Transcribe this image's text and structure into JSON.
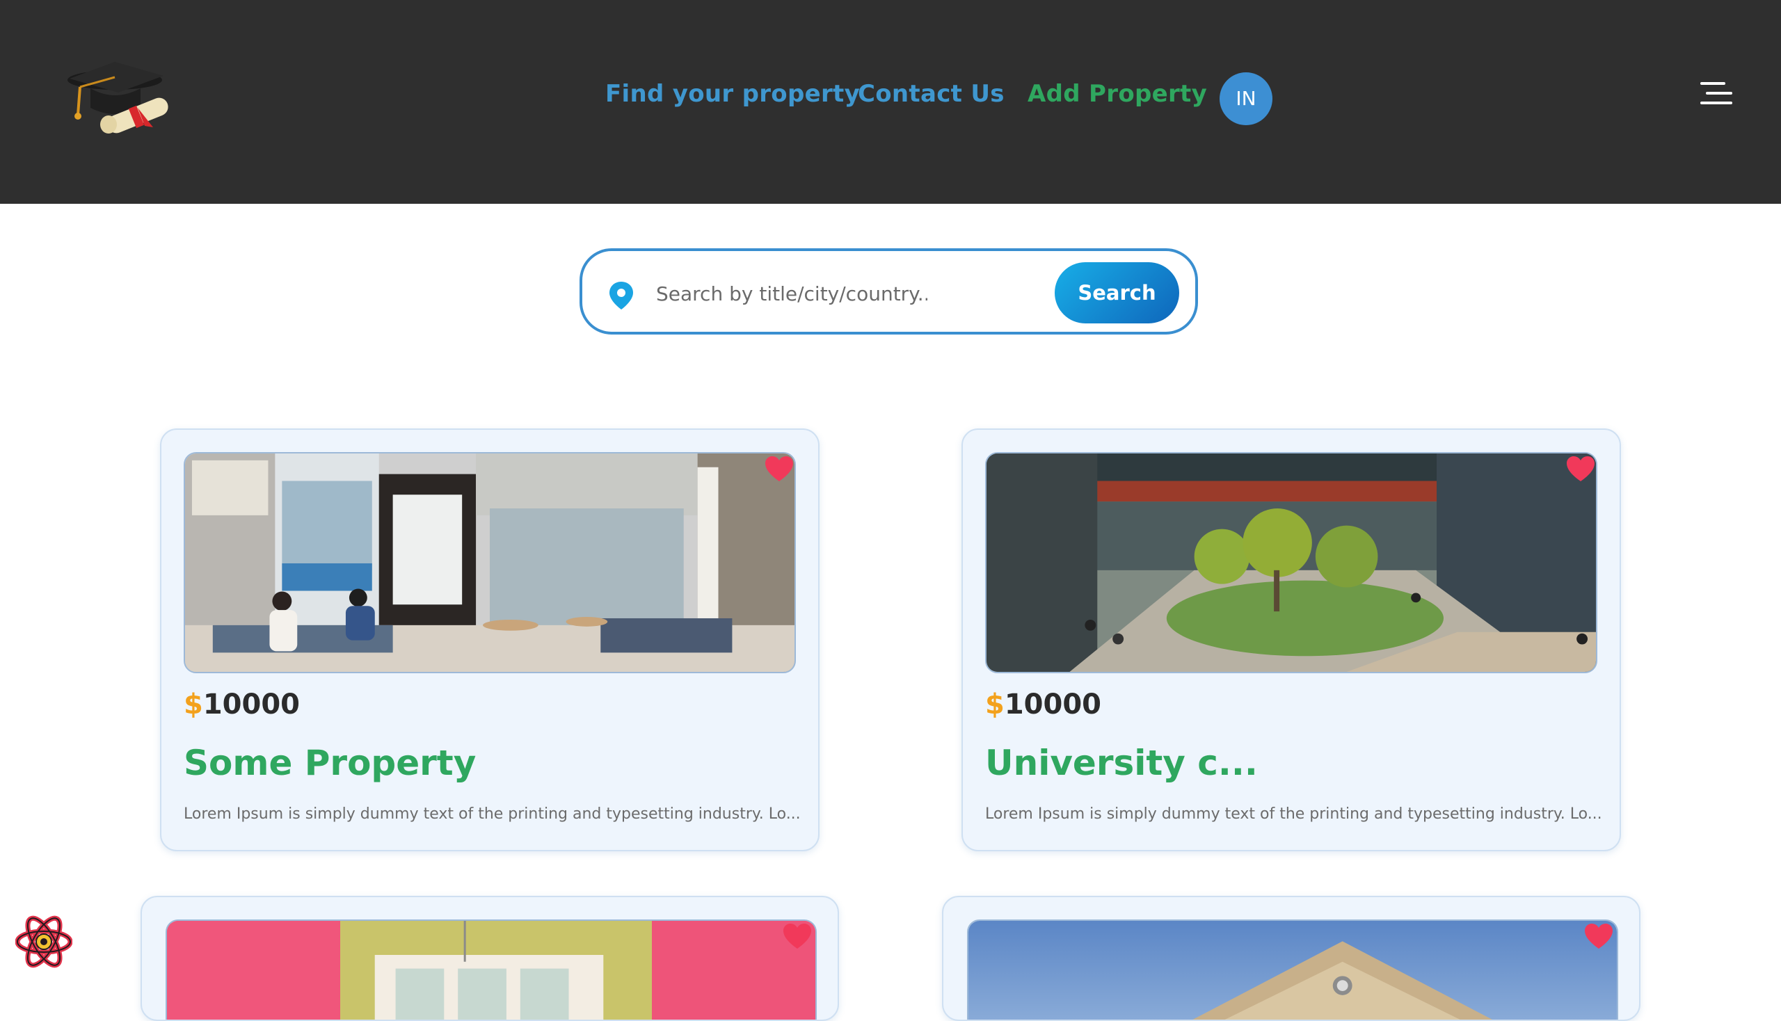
{
  "header": {
    "logo": "graduation-cap-diploma-logo",
    "nav": [
      {
        "label": "Find your property",
        "color": "#3f97cf"
      },
      {
        "label": "Contact Us",
        "color": "#3f97cf"
      },
      {
        "label": "Add Property",
        "color": "#2fa75f"
      }
    ],
    "avatar_initials": "IN",
    "menu_icon": "hamburger-menu-icon"
  },
  "search": {
    "icon": "map-pin-icon",
    "placeholder": "Search by title/city/country...",
    "value": "",
    "button_label": "Search"
  },
  "cards": [
    {
      "currency": "$",
      "price": "10000",
      "title": "Some Property",
      "description": "Lorem Ipsum is simply dummy text of the printing and typesetting industry. Lo...",
      "favorite_icon": "heart-icon"
    },
    {
      "currency": "$",
      "price": "10000",
      "title": "University c...",
      "description": "Lorem Ipsum is simply dummy text of the printing and typesetting industry. Lo...",
      "favorite_icon": "heart-icon"
    },
    {
      "favorite_icon": "heart-icon"
    },
    {
      "favorite_icon": "heart-icon"
    }
  ],
  "floating": {
    "icon": "react-devtools-icon"
  },
  "colors": {
    "header_bg": "#2f2f2f",
    "accent_blue": "#3a8fd0",
    "accent_green": "#2fa75f",
    "price_dollar": "#f3a11c",
    "heart": "#f1395a"
  }
}
